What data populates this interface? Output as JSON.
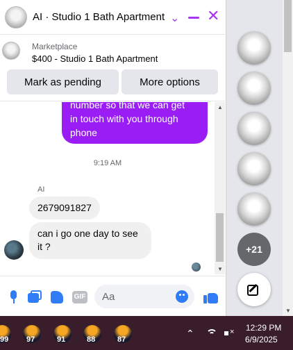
{
  "header": {
    "title": "AI · Studio 1 Bath Apartment"
  },
  "listing": {
    "marketplace_label": "Marketplace",
    "item_title": "$400 - Studio 1 Bath Apartment",
    "mark_pending_label": "Mark as pending",
    "more_options_label": "More options"
  },
  "messages": {
    "sent_lines": [
      "number so that we can get",
      "in touch with you through",
      "phone"
    ],
    "timestamp": "9:19 AM",
    "sender_name": "AI",
    "received": [
      "2679091827",
      "can i go one day to see it ?"
    ]
  },
  "composer": {
    "placeholder": "Aa",
    "gif_label": "GIF"
  },
  "side": {
    "more_chats_label": "+21"
  },
  "taskbar": {
    "badges": [
      "99",
      "97",
      "91",
      "88",
      "87"
    ],
    "time": "12:29 PM",
    "date": "6/9/2025"
  },
  "colors": {
    "accent": "#a634f0",
    "sent_bubble": "#9b1df5",
    "icon_blue": "#2f7cf6",
    "taskbar": "#3a1d2a"
  }
}
